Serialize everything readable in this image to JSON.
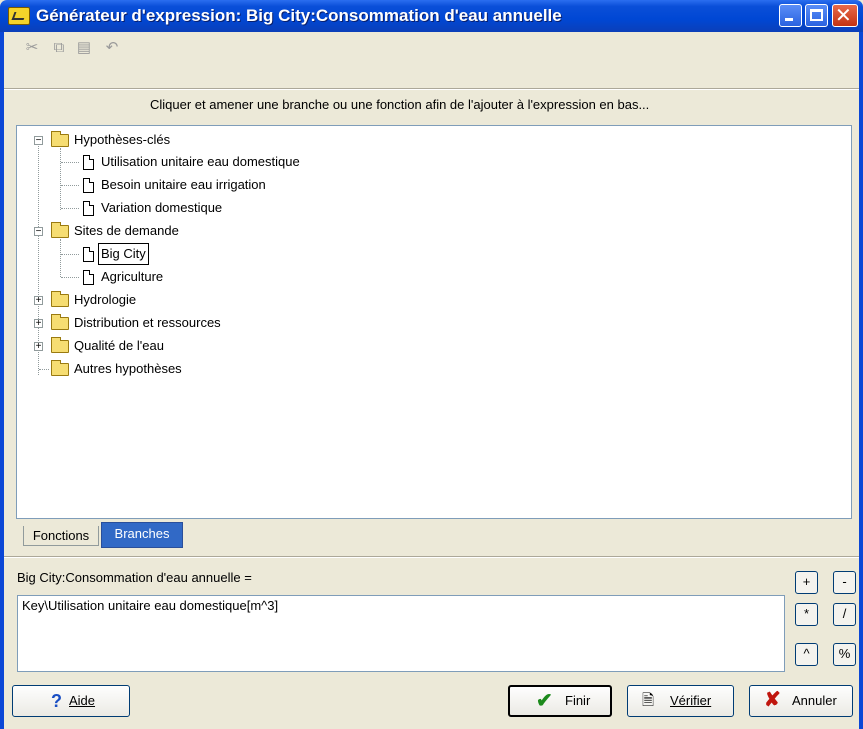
{
  "window": {
    "title": "Générateur d'expression: Big City:Consommation d'eau annuelle"
  },
  "toolbar": {
    "cut_icon": "scissors-icon",
    "copy_icon": "copy-icon",
    "paste_icon": "paste-icon",
    "undo_icon": "undo-icon"
  },
  "hint": "Cliquer et amener une branche ou une fonction afin de l'ajouter à l'expression en bas...",
  "tree": {
    "groups": [
      {
        "label": "Hypothèses-clés",
        "expanded": true,
        "children": [
          "Utilisation unitaire eau domestique",
          "Besoin unitaire eau irrigation",
          "Variation domestique"
        ]
      },
      {
        "label": "Sites de demande",
        "expanded": true,
        "children": [
          "Big City",
          "Agriculture"
        ]
      },
      {
        "label": "Hydrologie",
        "expanded": false
      },
      {
        "label": "Distribution et ressources",
        "expanded": false
      },
      {
        "label": "Qualité de l'eau",
        "expanded": false
      },
      {
        "label": "Autres hypothèses",
        "expanded": false
      }
    ],
    "selected": "Big City"
  },
  "tabs": {
    "functions": "Fonctions",
    "branches": "Branches",
    "active": "Branches"
  },
  "expression": {
    "label": "Big City:Consommation d'eau annuelle =",
    "value": "Key\\Utilisation unitaire eau domestique[m^3]"
  },
  "operators": [
    "+",
    "-",
    "*",
    "/",
    "^",
    "%"
  ],
  "buttons": {
    "help": "Aide",
    "finish": "Finir",
    "verify": "Vérifier",
    "cancel": "Annuler"
  },
  "colors": {
    "titlebar": "#0047d4",
    "tab_active": "#3169c6",
    "folder": "#f6dd72"
  }
}
